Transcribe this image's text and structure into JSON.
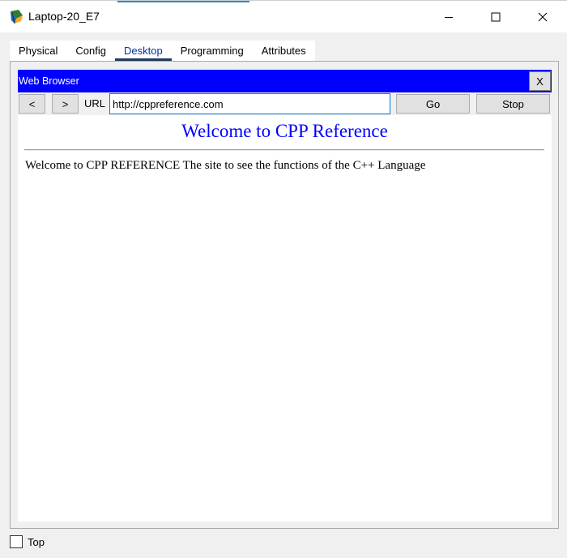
{
  "window": {
    "title": "Laptop-20_E7",
    "controls": {
      "minimize": "minimize-icon",
      "maximize": "maximize-icon",
      "close": "close-icon"
    }
  },
  "tabs": [
    {
      "label": "Physical",
      "active": false
    },
    {
      "label": "Config",
      "active": false
    },
    {
      "label": "Desktop",
      "active": true
    },
    {
      "label": "Programming",
      "active": false
    },
    {
      "label": "Attributes",
      "active": false
    }
  ],
  "browser": {
    "title": "Web Browser",
    "close_label": "X",
    "back_label": "<",
    "forward_label": ">",
    "url_label": "URL",
    "url_value": "http://cppreference.com",
    "go_label": "Go",
    "stop_label": "Stop",
    "header_color": "#0000ff"
  },
  "page": {
    "heading": "Welcome to CPP Reference",
    "body": "Welcome to CPP REFERENCE The site to see the functions of the C++ Language",
    "heading_color": "#0000ff"
  },
  "footer": {
    "top_label": "Top",
    "top_checked": false
  }
}
